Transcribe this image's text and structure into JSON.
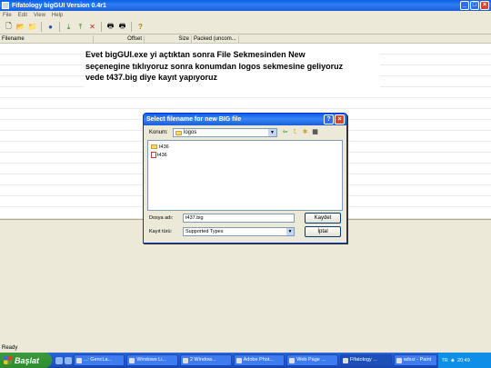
{
  "window": {
    "title": "Fifatology bigGUI Version 0.4r1",
    "buttons": [
      "_",
      "□",
      "×"
    ]
  },
  "menu": [
    "File",
    "Edit",
    "View",
    "Help"
  ],
  "columns": {
    "filename": "Filename",
    "offset": "Offset",
    "size": "Size",
    "packed": "Packed (uncom..."
  },
  "annotation": {
    "line1": "Evet bigGUI.exe yi açtıktan sonra File Sekmesinden New",
    "line2": "seçenegine tıklıyoruz sonra konumdan logos sekmesine geliyoruz",
    "line3": "vede t437.big diye kayıt yapıyoruz"
  },
  "dialog": {
    "title": "Select filename for new BIG file",
    "help": "?",
    "close": "×",
    "look_in_label": "Konum:",
    "look_in_value": "logos",
    "files": [
      "t436",
      "t436"
    ],
    "filename_label": "Dosya adı:",
    "filename_value": "t437.big",
    "filetype_label": "Kayıt türü:",
    "filetype_value": "Supported Types",
    "save_button": "Kaydet",
    "cancel_button": "İptal"
  },
  "status": "Ready",
  "taskbar": {
    "start": "Başlat",
    "tasks": [
      "...: GencLa...",
      "Windows Li...",
      "2 Window...",
      "Adobe Phot...",
      "Web Page ...",
      "Fifatology ...",
      "adsız - Paint"
    ],
    "active_index": 5,
    "lang": "TR",
    "clock": "20:49"
  }
}
